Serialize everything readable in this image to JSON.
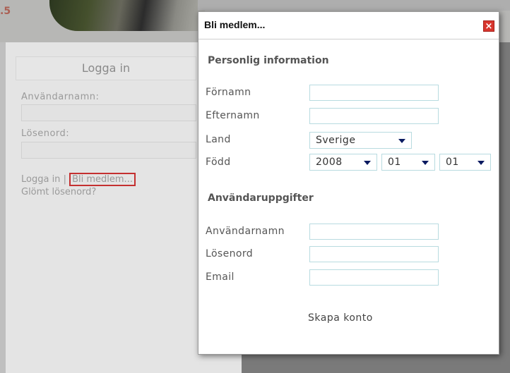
{
  "background": {
    "version_label": ".5",
    "login_title": "Logga in",
    "username_label": "Användarnamn:",
    "password_label": "Lösenord:",
    "login_link": "Logga in",
    "link_separator": "|",
    "register_link": "Bli medlem...",
    "forgot_link": "Glömt lösenord?"
  },
  "modal": {
    "title": "Bli medlem...",
    "close_glyph": "×",
    "personal_section": "Personlig information",
    "first_name_label": "Förnamn",
    "last_name_label": "Efternamn",
    "country_label": "Land",
    "country_value": "Sverige",
    "born_label": "Född",
    "birth_year": "2008",
    "birth_month": "01",
    "birth_day": "01",
    "account_section": "Användaruppgifter",
    "username_label": "Användarnamn",
    "password_label": "Lösenord",
    "email_label": "Email",
    "submit_label": "Skapa konto"
  },
  "colors": {
    "close_red": "#d8362e",
    "input_border": "#b8dbe0",
    "highlight_red": "#c43030"
  }
}
